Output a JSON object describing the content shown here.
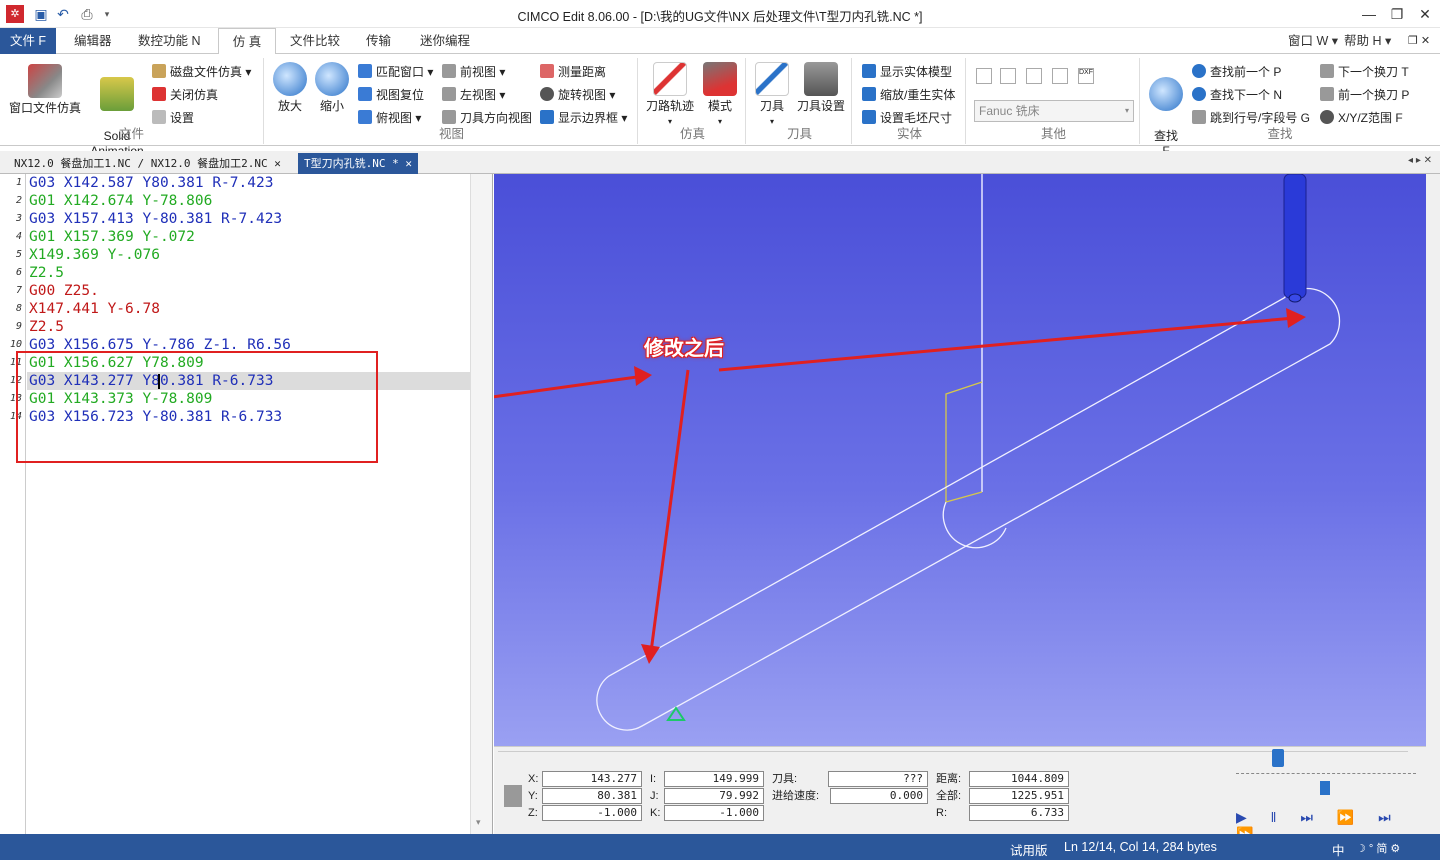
{
  "title_bar": {
    "app_title": "CIMCO Edit 8.06.00 - [D:\\我的UG文件\\NX 后处理文件\\T型刀内孔铣.NC *]",
    "quick_access": [
      "app-logo-icon",
      "save-icon",
      "undo-icon",
      "print-icon",
      "dropdown-icon"
    ]
  },
  "menu": {
    "file": "文件 F",
    "tabs": [
      "编辑器",
      "数控功能 N",
      "仿 真",
      "文件比较",
      "传输",
      "迷你编程"
    ],
    "active_tab": "仿 真",
    "right": {
      "window": "窗口 W",
      "help": "帮助 H"
    }
  },
  "ribbon": {
    "file_group": {
      "label": "文件",
      "window_sim": "窗口文件仿真",
      "solid_anim": "Solid\nAnimation",
      "disk_sim": "磁盘文件仿真",
      "close_sim": "关闭仿真",
      "settings": "设置"
    },
    "view_group": {
      "label": "视图",
      "zoom_in": "放大",
      "zoom_out": "缩小",
      "fit_window": "匹配窗口",
      "reset_view": "视图复位",
      "top_view": "俯视图",
      "front_view": "前视图",
      "left_view": "左视图",
      "tool_dir_view": "刀具方向视图",
      "measure": "测量距离",
      "rotate_view": "旋转视图",
      "show_bounds": "显示边界框"
    },
    "sim_group": {
      "label": "仿真",
      "toolpath": "刀路轨迹",
      "mode": "模式"
    },
    "tool_group": {
      "label": "刀具",
      "tool": "刀具",
      "tool_setup": "刀具设置"
    },
    "solid_group": {
      "label": "实体",
      "show_solid": "显示实体模型",
      "zoom_regen": "缩放/重生实体",
      "stock_size": "设置毛坯尺寸"
    },
    "other_group": {
      "label": "其他",
      "machine_select": "Fanuc 铣床"
    },
    "find_group": {
      "label": "查找",
      "find": "查找\nF",
      "find_prev": "查找前一个 P",
      "find_next": "查找下一个 N",
      "goto_line": "跳到行号/字段号 G",
      "next_tool": "下一个换刀 T",
      "prev_tool": "前一个换刀 P",
      "xyz_range": "X/Y/Z范围 F"
    }
  },
  "doc_tabs": [
    "NX12.0 餐盘加工1.NC / NX12.0 餐盘加工2.NC",
    "T型刀内孔铣.NC *"
  ],
  "editor": {
    "lines": [
      {
        "n": "1",
        "text": "G03 X142.587 Y80.381 R-7.423",
        "color": "#1f2fb8"
      },
      {
        "n": "2",
        "text": "G01 X142.674 Y-78.806",
        "color": "#22aa22"
      },
      {
        "n": "3",
        "text": "G03 X157.413 Y-80.381 R-7.423",
        "color": "#1f2fb8"
      },
      {
        "n": "4",
        "text": "G01 X157.369 Y-.072",
        "color": "#22aa22"
      },
      {
        "n": "5",
        "text": "X149.369 Y-.076",
        "color": "#22aa22"
      },
      {
        "n": "6",
        "text": "Z2.5",
        "color": "#22aa22"
      },
      {
        "n": "7",
        "text": "G00 Z25.",
        "color": "#c01818"
      },
      {
        "n": "8",
        "text": "X147.441 Y-6.78",
        "color": "#c01818"
      },
      {
        "n": "9",
        "text": "Z2.5",
        "color": "#c01818"
      },
      {
        "n": "10",
        "text": "G03 X156.675 Y-.786 Z-1. R6.56",
        "color": "#1f2fb8"
      },
      {
        "n": "11",
        "text": "G01 X156.627 Y78.809",
        "color": "#22aa22"
      },
      {
        "n": "12",
        "text": "G03 X143.277 Y80.381 R-6.733",
        "color": "#1f2fb8"
      },
      {
        "n": "13",
        "text": "G01 X143.373 Y-78.809",
        "color": "#22aa22"
      },
      {
        "n": "14",
        "text": "G03 X156.723 Y-80.381 R-6.733",
        "color": "#1f2fb8"
      }
    ],
    "current_line": 12
  },
  "annotation": {
    "label": "修改之后"
  },
  "readout": {
    "x_label": "X:",
    "x": "143.277",
    "y_label": "Y:",
    "y": "80.381",
    "z_label": "Z:",
    "z": "-1.000",
    "i_label": "I:",
    "i": "149.999",
    "j_label": "J:",
    "j": "79.992",
    "k_label": "K:",
    "k": "-1.000",
    "tool_label": "刀具:",
    "tool": "???",
    "feed_label": "进给速度:",
    "feed": "0.000",
    "dist_label": "距离:",
    "dist": "1044.809",
    "total_label": "全部:",
    "total": "1225.951",
    "r_label": "R:",
    "r": "6.733"
  },
  "status_bar": {
    "mode": "试用版",
    "position": "Ln 12/14, Col 14, 284 bytes",
    "ime": "中"
  }
}
